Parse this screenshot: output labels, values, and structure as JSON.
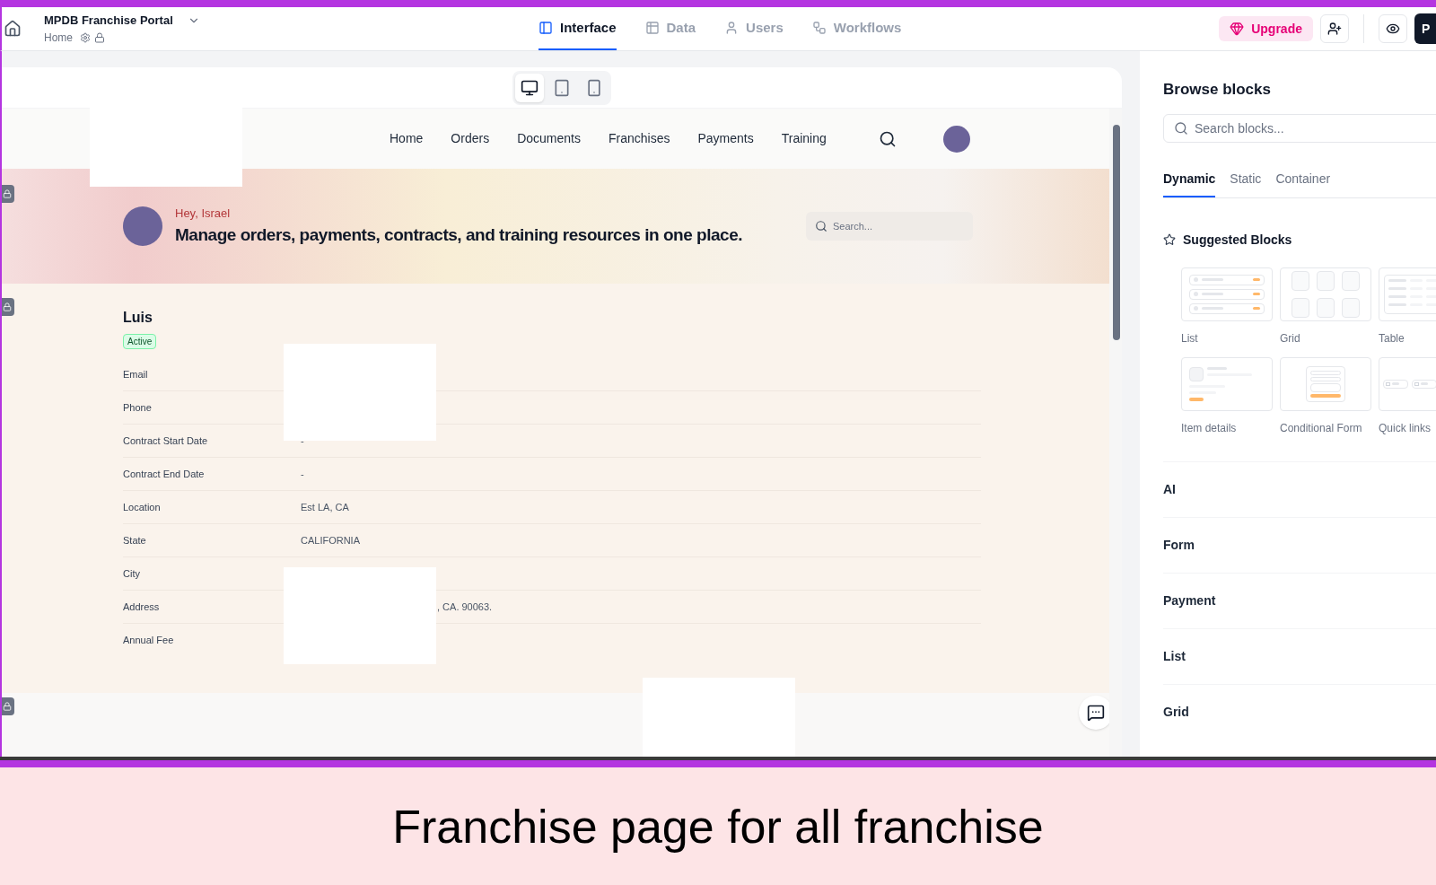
{
  "app": {
    "title": "MPDB Franchise Portal",
    "breadcrumb": "Home"
  },
  "top_tabs": [
    {
      "label": "Interface",
      "selected": true,
      "kind": "layout"
    },
    {
      "label": "Data",
      "selected": false,
      "kind": "table"
    },
    {
      "label": "Users",
      "selected": false,
      "kind": "user"
    },
    {
      "label": "Workflows",
      "selected": false,
      "kind": "workflow"
    }
  ],
  "upgrade_button": "Upgrade",
  "publish_button": "P",
  "devices": [
    {
      "kind": "desktop",
      "selected": true
    },
    {
      "kind": "tablet",
      "selected": false
    },
    {
      "kind": "mobile",
      "selected": false
    }
  ],
  "page_nav": [
    "Home",
    "Orders",
    "Documents",
    "Franchises",
    "Payments",
    "Training"
  ],
  "hero": {
    "greeting": "Hey, Israel",
    "headline": "Manage orders, payments, contracts, and training resources in one place.",
    "search_placeholder": "Search..."
  },
  "record": {
    "name": "Luis",
    "status": "Active",
    "fields": [
      {
        "label": "Email"
      },
      {
        "label": "Phone"
      },
      {
        "label": "Contract Start Date",
        "value": "-"
      },
      {
        "label": "Contract End Date",
        "value": "-"
      },
      {
        "label": "Location",
        "value": "Est LA, CA"
      },
      {
        "label": "State",
        "value": "CALIFORNIA"
      },
      {
        "label": "City"
      },
      {
        "label": "Address",
        "value": ", CA. 90063.",
        "kind": "partial"
      },
      {
        "label": "Annual Fee"
      }
    ]
  },
  "panel": {
    "title": "Browse blocks",
    "search_placeholder": "Search blocks...",
    "tabs": [
      {
        "label": "Dynamic",
        "selected": true
      },
      {
        "label": "Static",
        "selected": false
      },
      {
        "label": "Container",
        "selected": false
      }
    ],
    "suggested_title": "Suggested Blocks",
    "suggested": [
      {
        "label": "List",
        "kind": "list"
      },
      {
        "label": "Grid",
        "kind": "grid"
      },
      {
        "label": "Table",
        "kind": "table"
      },
      {
        "label": "Item details",
        "kind": "details"
      },
      {
        "label": "Conditional Form",
        "kind": "form"
      },
      {
        "label": "Quick links",
        "kind": "links"
      }
    ],
    "sections": [
      "AI",
      "Form",
      "Payment",
      "List",
      "Grid"
    ]
  },
  "caption": "Franchise page for all franchise"
}
